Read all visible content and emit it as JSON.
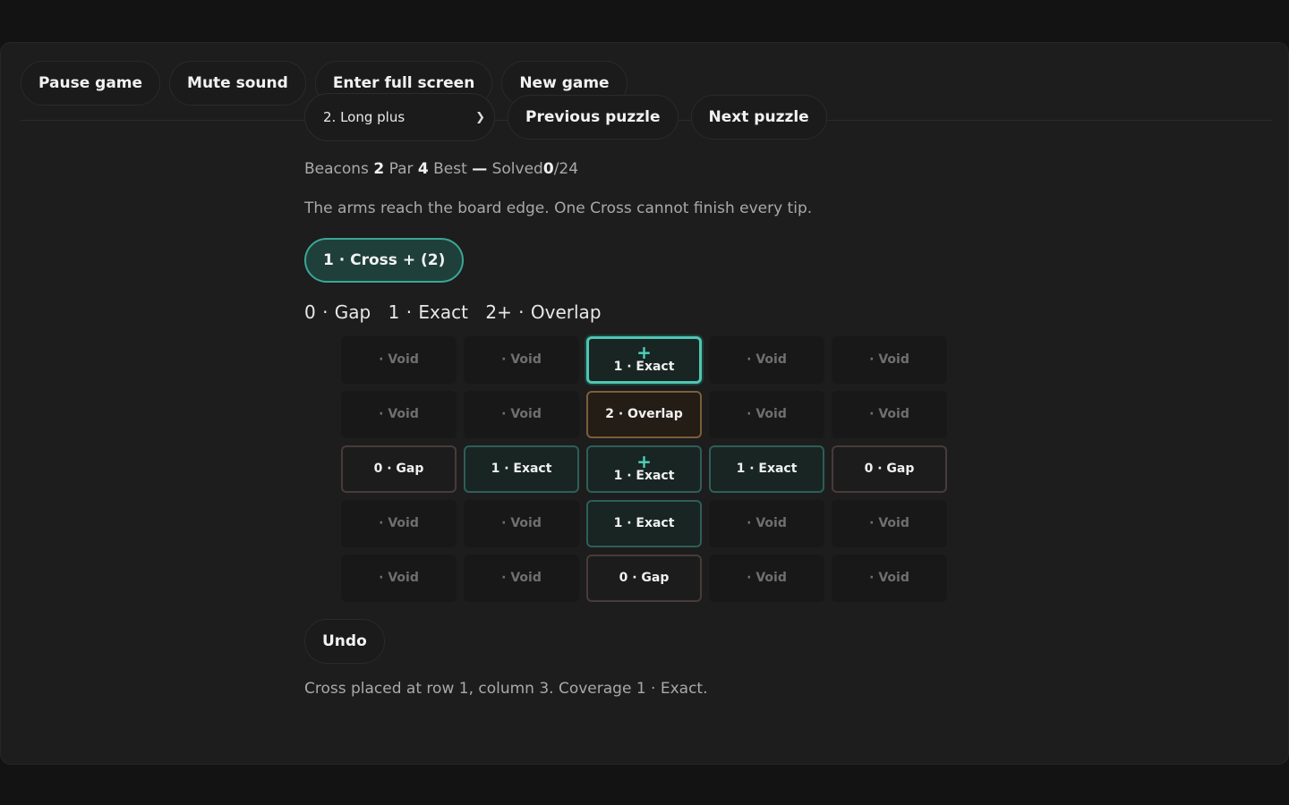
{
  "toolbar": {
    "pause": "Pause game",
    "mute": "Mute sound",
    "fullscreen": "Enter full screen",
    "new_game": "New game"
  },
  "puzzle": {
    "selected": "2. Long plus",
    "prev": "Previous puzzle",
    "next": "Next puzzle"
  },
  "stats": {
    "beacons_label": "Beacons",
    "beacons": "2",
    "par_label": "Par",
    "par": "4",
    "best_label": "Best",
    "best": "—",
    "solved_label": "Solved",
    "solved": "0",
    "total": "/24"
  },
  "message": "The arms reach the board edge. One Cross cannot finish every tip.",
  "piece_label": "1 · Cross + (2)",
  "legend": [
    "0 · Gap",
    "1 · Exact",
    "2+ · Overlap"
  ],
  "board": [
    [
      {
        "t": "void",
        "l": "· Void"
      },
      {
        "t": "void",
        "l": "· Void"
      },
      {
        "t": "exact",
        "l": "1 · Exact",
        "plus": true,
        "sel": true
      },
      {
        "t": "void",
        "l": "· Void"
      },
      {
        "t": "void",
        "l": "· Void"
      }
    ],
    [
      {
        "t": "void",
        "l": "· Void"
      },
      {
        "t": "void",
        "l": "· Void"
      },
      {
        "t": "overlap",
        "l": "2 · Overlap"
      },
      {
        "t": "void",
        "l": "· Void"
      },
      {
        "t": "void",
        "l": "· Void"
      }
    ],
    [
      {
        "t": "gap",
        "l": "0 · Gap"
      },
      {
        "t": "exact",
        "l": "1 · Exact"
      },
      {
        "t": "exact",
        "l": "1 · Exact",
        "plus": true
      },
      {
        "t": "exact",
        "l": "1 · Exact"
      },
      {
        "t": "gap",
        "l": "0 · Gap"
      }
    ],
    [
      {
        "t": "void",
        "l": "· Void"
      },
      {
        "t": "void",
        "l": "· Void"
      },
      {
        "t": "exact",
        "l": "1 · Exact"
      },
      {
        "t": "void",
        "l": "· Void"
      },
      {
        "t": "void",
        "l": "· Void"
      }
    ],
    [
      {
        "t": "void",
        "l": "· Void"
      },
      {
        "t": "void",
        "l": "· Void"
      },
      {
        "t": "gap",
        "l": "0 · Gap"
      },
      {
        "t": "void",
        "l": "· Void"
      },
      {
        "t": "void",
        "l": "· Void"
      }
    ]
  ],
  "plus_glyph": "+",
  "undo": "Undo",
  "status": "Cross placed at row 1, column 3. Coverage 1 · Exact.",
  "colors": {
    "accent": "#4fc6b2",
    "overlap": "#7a5f38",
    "gap": "#4a3a3a"
  }
}
